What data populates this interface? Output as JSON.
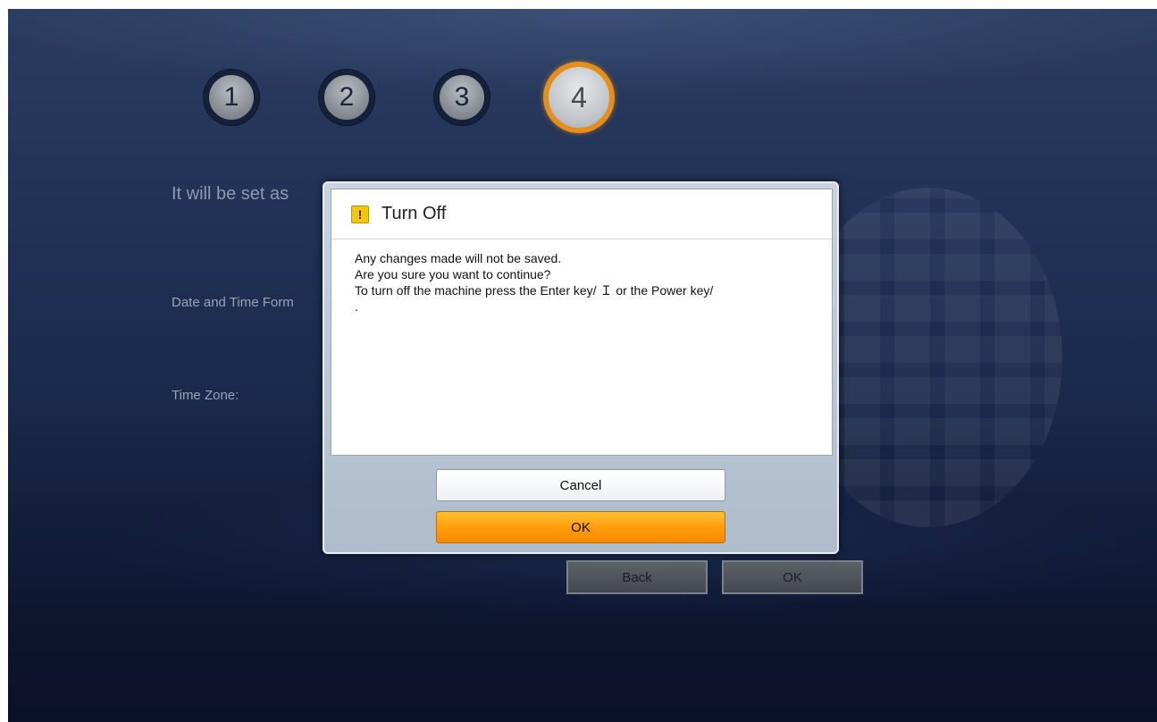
{
  "steps": [
    "1",
    "2",
    "3",
    "4"
  ],
  "active_step": "4",
  "background": {
    "heading": "It will be set as",
    "date_time_format_label": "Date and Time Form",
    "time_zone_label": "Time Zone:",
    "back_button": "Back",
    "ok_button": "OK"
  },
  "dialog": {
    "title": "Turn Off",
    "icon": "warning-icon",
    "lines": [
      "Any changes made will not be saved.",
      "Are you sure you want to continue?",
      "To turn off the machine press the Enter key/ Ｉ  or the Power key/",
      "."
    ],
    "cancel_button": "Cancel",
    "ok_button": "OK"
  },
  "colors": {
    "accent": "#f48a00",
    "active_step_ring": "#e58e1a",
    "background_top": "#2a3c5f",
    "background_bottom": "#0a1128"
  }
}
